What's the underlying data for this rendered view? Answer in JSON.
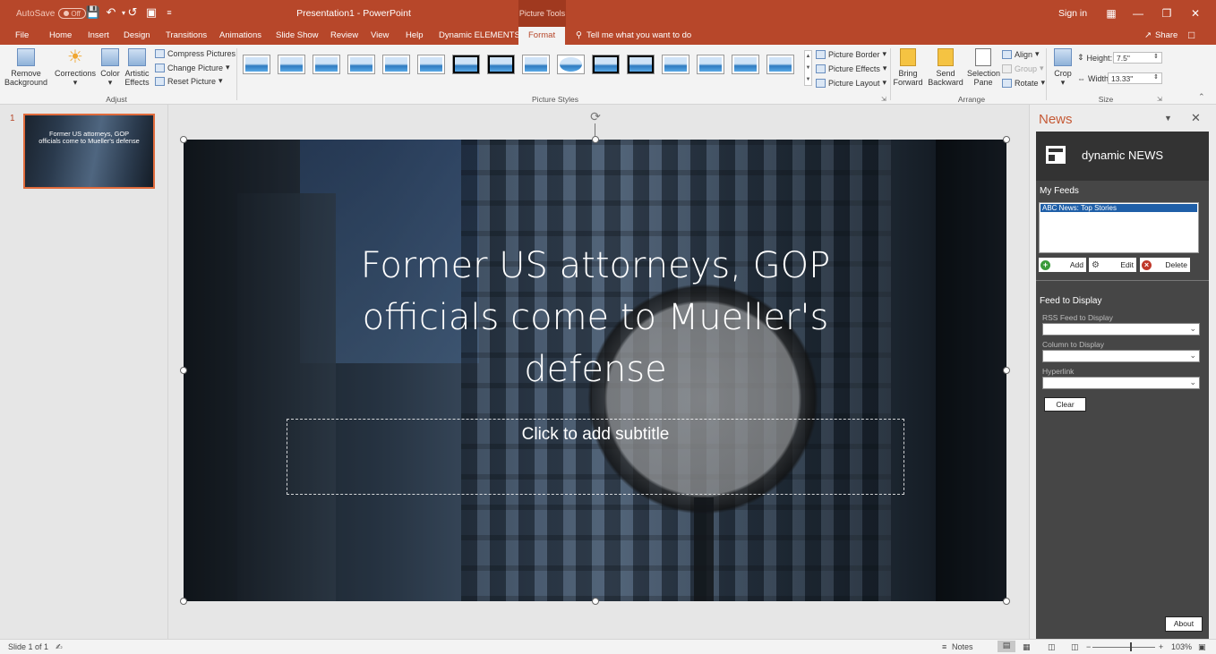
{
  "titlebar": {
    "autosave_label": "AutoSave",
    "autosave_state": "Off",
    "doc_title": "Presentation1 - PowerPoint",
    "context_group": "Picture Tools",
    "sign_in": "Sign in"
  },
  "tabs": [
    "File",
    "Home",
    "Insert",
    "Design",
    "Transitions",
    "Animations",
    "Slide Show",
    "Review",
    "View",
    "Help",
    "Dynamic ELEMENTS"
  ],
  "active_tab": "Format",
  "tell_me": "Tell me what you want to do",
  "share": "Share",
  "ribbon": {
    "adjust": {
      "remove_bg_1": "Remove",
      "remove_bg_2": "Background",
      "corrections": "Corrections",
      "color": "Color",
      "artistic_1": "Artistic",
      "artistic_2": "Effects",
      "compress": "Compress Pictures",
      "change": "Change Picture",
      "reset": "Reset Picture",
      "group_label": "Adjust"
    },
    "styles": {
      "border": "Picture Border",
      "effects": "Picture Effects",
      "layout": "Picture Layout",
      "group_label": "Picture Styles"
    },
    "arrange": {
      "bring_1": "Bring",
      "bring_2": "Forward",
      "send_1": "Send",
      "send_2": "Backward",
      "selection_1": "Selection",
      "selection_2": "Pane",
      "align": "Align",
      "group": "Group",
      "rotate": "Rotate",
      "group_label": "Arrange"
    },
    "size": {
      "crop": "Crop",
      "height_label": "Height:",
      "height_value": "7.5\"",
      "width_label": "Width:",
      "width_value": "13.33\"",
      "group_label": "Size"
    }
  },
  "thumbnail": {
    "number": "1",
    "text": "Former US attorneys, GOP officials come to Mueller's defense"
  },
  "slide": {
    "title": "Former US attorneys, GOP officials come to Mueller's defense",
    "subtitle_placeholder": "Click to add subtitle"
  },
  "news": {
    "pane_title": "News",
    "brand": "dynamic NEWS",
    "my_feeds": "My Feeds",
    "feeds": [
      "ABC News: Top Stories"
    ],
    "add": "Add",
    "edit": "Edit",
    "delete": "Delete",
    "feed_to_display": "Feed to Display",
    "rss_label": "RSS Feed to Display",
    "column_label": "Column to Display",
    "hyperlink_label": "Hyperlink",
    "clear": "Clear",
    "about": "About"
  },
  "status": {
    "slide_of": "Slide 1 of 1",
    "notes": "Notes",
    "zoom": "103%",
    "zoom_fraction": 0.6
  }
}
